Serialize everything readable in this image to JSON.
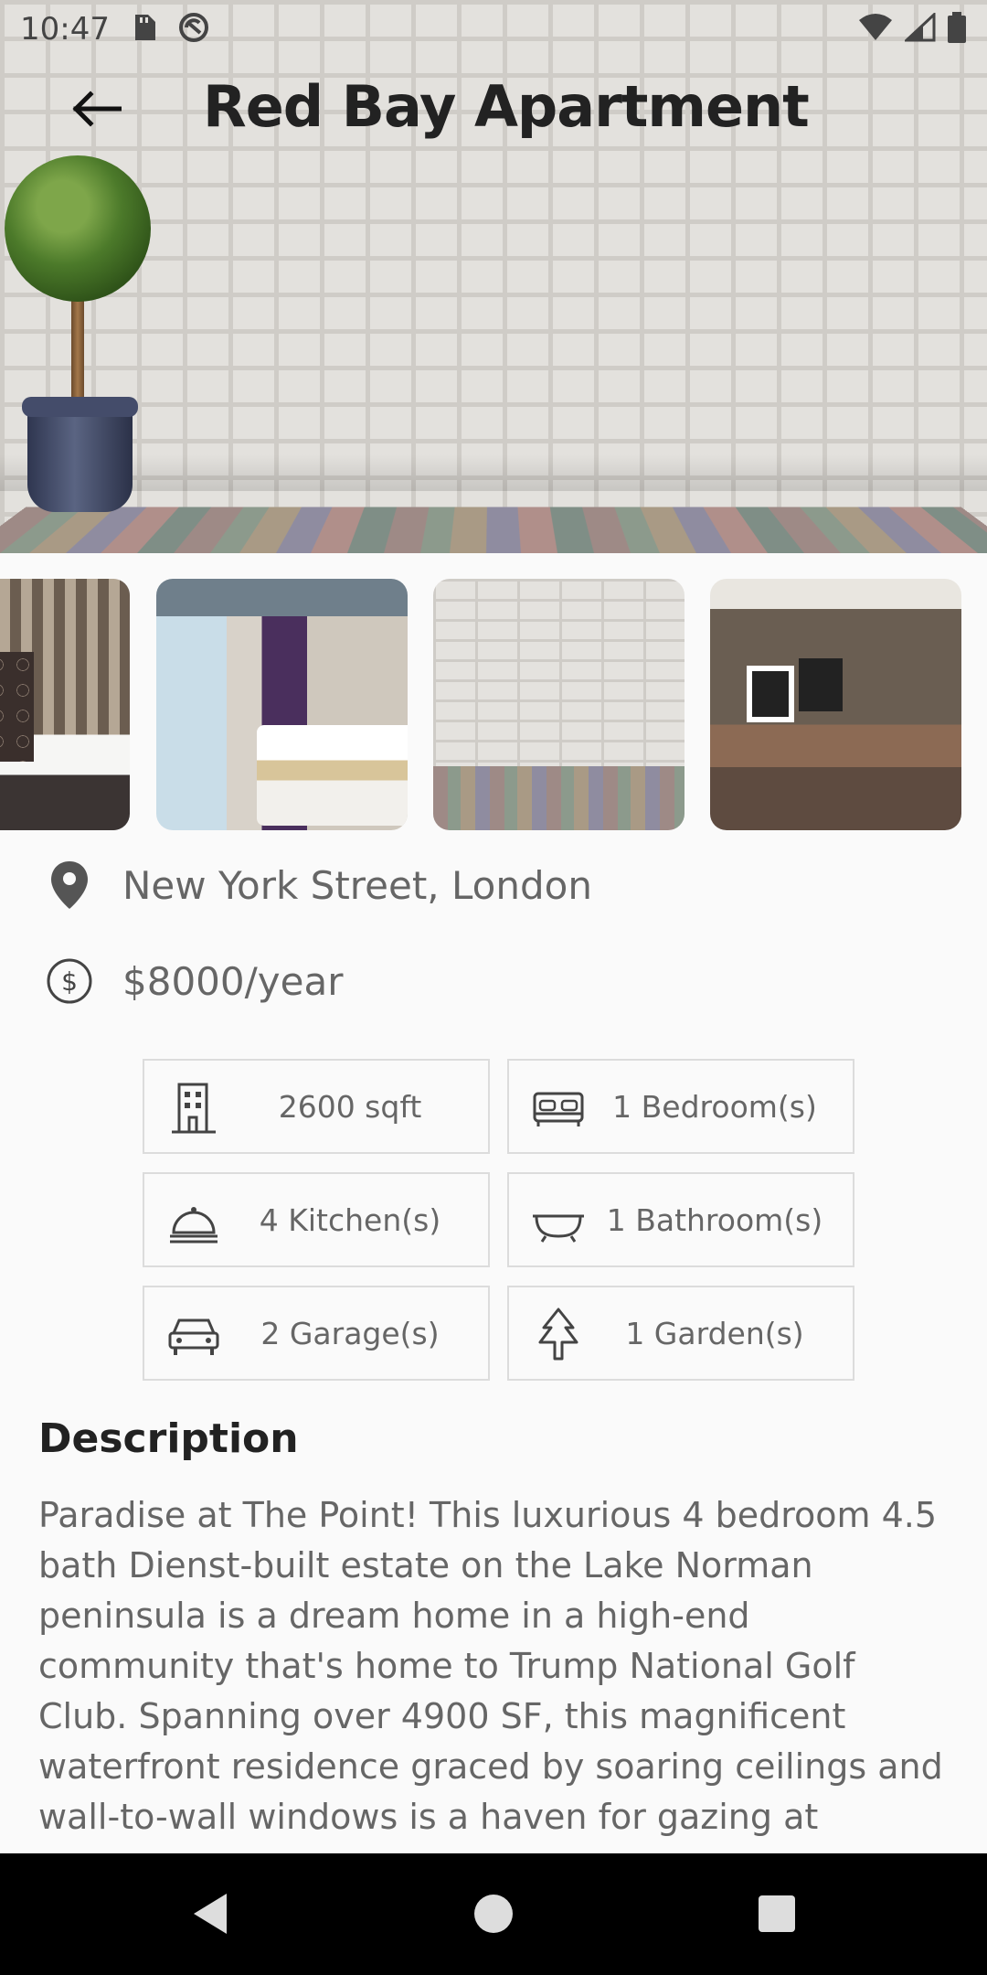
{
  "status_bar": {
    "time": "10:47",
    "left_icons": [
      "sd-card-icon",
      "sync-icon"
    ],
    "right_icons": [
      "wifi-icon",
      "cell-signal-icon",
      "battery-icon"
    ]
  },
  "header": {
    "title": "Red Bay Apartment",
    "back_icon": "arrow-left-icon"
  },
  "gallery": {
    "thumbnails": [
      "bedroom-ornate-wall",
      "hotel-bedroom-purple",
      "brick-wall-wood-floor",
      "suite-living-room"
    ]
  },
  "location": {
    "text": "New York Street, London",
    "icon": "location-pin-icon"
  },
  "price": {
    "text": "$8000/year",
    "icon": "dollar-circle-icon"
  },
  "features": [
    {
      "label": "2600 sqft",
      "icon": "building-icon"
    },
    {
      "label": "1 Bedroom(s)",
      "icon": "bed-icon"
    },
    {
      "label": "4 Kitchen(s)",
      "icon": "cloche-icon"
    },
    {
      "label": "1 Bathroom(s)",
      "icon": "bathtub-icon"
    },
    {
      "label": "2 Garage(s)",
      "icon": "car-icon"
    },
    {
      "label": "1 Garden(s)",
      "icon": "tree-icon"
    }
  ],
  "description": {
    "title": "Description",
    "text": "Paradise at The Point! This luxurious 4 bedroom 4.5 bath Dienst-built estate on the Lake Norman peninsula is a dream home in a high-end community that's home to Trump National Golf Club. Spanning over 4900 SF, this magnificent waterfront residence graced by soaring ceilings and wall-to-wall windows is a haven for gazing at"
  },
  "nav_bar": {
    "buttons": [
      "back",
      "home",
      "recents"
    ]
  },
  "colors": {
    "background": "#fafafa",
    "title": "#222222",
    "secondary_text": "#666666",
    "border": "#dcdcdc",
    "nav_bar": "#000000"
  }
}
